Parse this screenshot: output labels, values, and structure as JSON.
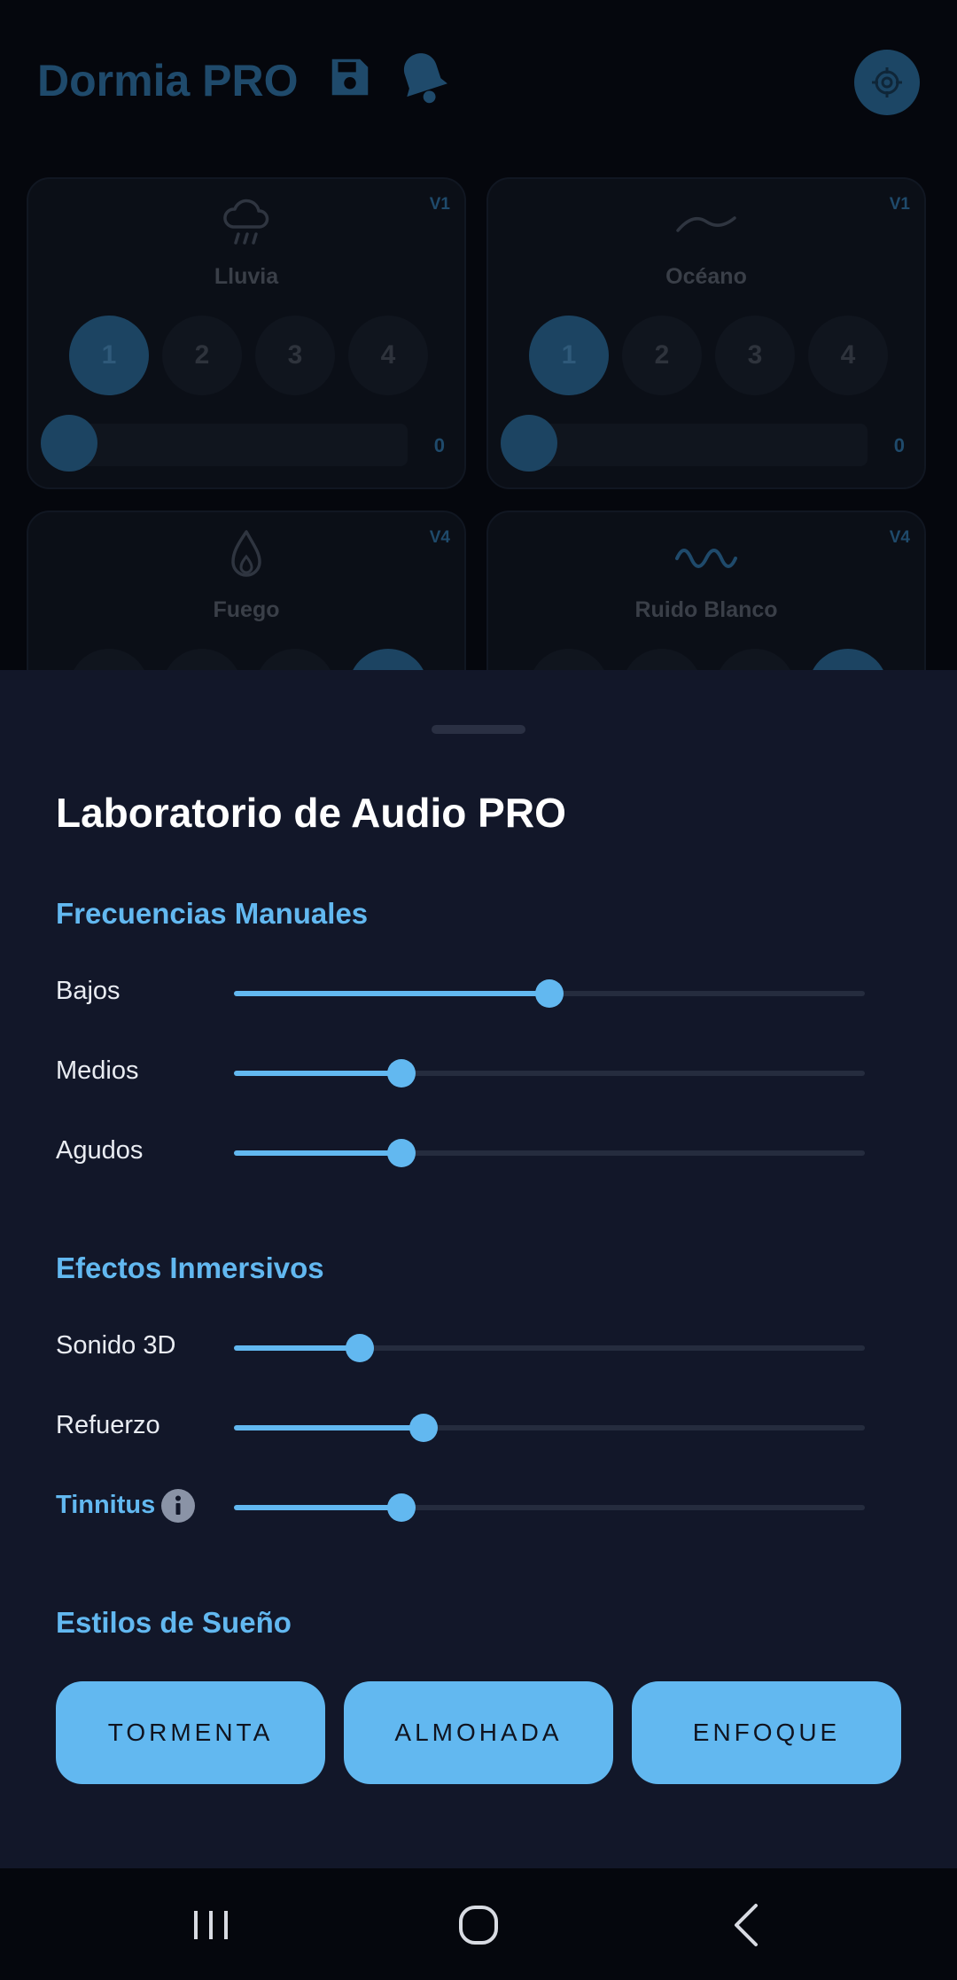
{
  "app": {
    "title": "Dormia PRO",
    "header_icons": [
      "save-icon",
      "bell-icon",
      "target-icon"
    ],
    "cards": [
      {
        "name": "Lluvia",
        "badge": "V1",
        "icon": "rain-cloud-icon",
        "levels": [
          "1",
          "2",
          "3",
          "4"
        ],
        "active_level": "1",
        "volume_text": "0",
        "volume": 0
      },
      {
        "name": "Océano",
        "badge": "V1",
        "icon": "wave-icon",
        "levels": [
          "1",
          "2",
          "3",
          "4"
        ],
        "active_level": "1",
        "volume_text": "0",
        "volume": 0
      },
      {
        "name": "Fuego",
        "badge": "V4",
        "icon": "flame-icon",
        "active_level": "4"
      },
      {
        "name": "Ruido Blanco",
        "badge": "V4",
        "icon": "sine-wave-icon",
        "active_level": "4"
      }
    ]
  },
  "sheet": {
    "title": "Laboratorio de Audio PRO",
    "sections": {
      "manual": {
        "title": "Frecuencias Manuales",
        "rows": [
          {
            "label": "Bajos",
            "value": 0.5
          },
          {
            "label": "Medios",
            "value": 0.265
          },
          {
            "label": "Agudos",
            "value": 0.265
          }
        ]
      },
      "effects": {
        "title": "Efectos Inmersivos",
        "rows": [
          {
            "label": "Sonido 3D",
            "value": 0.2
          },
          {
            "label": "Refuerzo",
            "value": 0.3
          },
          {
            "label": "Tinnitus",
            "value": 0.265,
            "icon": "info-icon"
          }
        ]
      },
      "styles": {
        "title": "Estilos de Sueño",
        "buttons": [
          "TORMENTA",
          "ALMOHADA",
          "ENFOQUE"
        ]
      }
    }
  },
  "navbar": {
    "icons": [
      "recent-apps-icon",
      "home-icon",
      "back-icon"
    ]
  },
  "colors": {
    "accent": "#62b8f0",
    "sheet_bg": "#121729",
    "app_bg": "#05070d"
  }
}
